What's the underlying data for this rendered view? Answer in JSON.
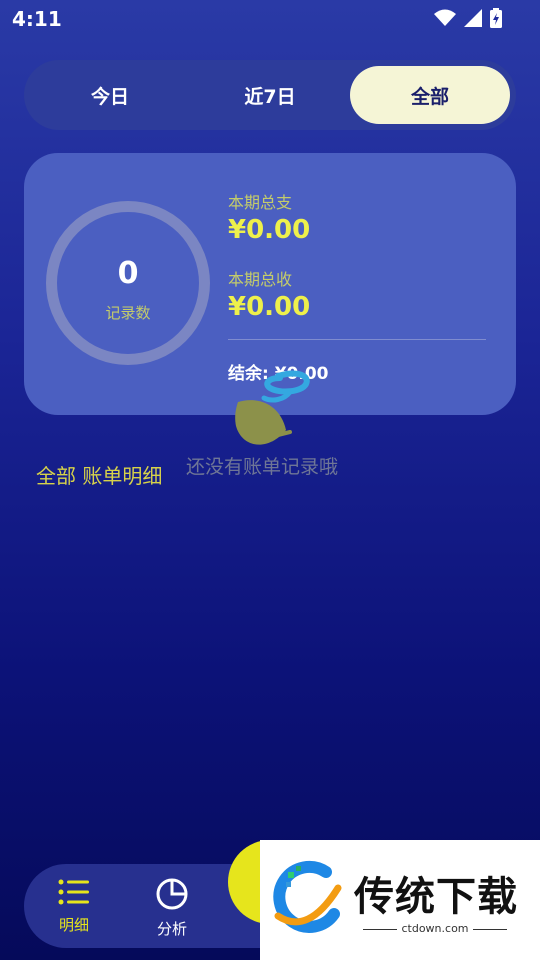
{
  "status_bar": {
    "time": "4:11",
    "icons": [
      "wifi-icon",
      "cell-signal-icon",
      "battery-charging-icon"
    ]
  },
  "range_tabs": [
    {
      "label": "今日",
      "active": false
    },
    {
      "label": "近7日",
      "active": false
    },
    {
      "label": "全部",
      "active": true
    }
  ],
  "summary": {
    "record_count": "0",
    "record_count_label": "记录数",
    "expense_label": "本期总支",
    "expense_value": "¥0.00",
    "income_label": "本期总收",
    "income_value": "¥0.00",
    "balance_text": "结余: ¥0.00"
  },
  "list": {
    "title": "全部 账单明细",
    "empty_text": "还没有账单记录哦"
  },
  "bottom_nav": [
    {
      "label": "明细",
      "icon": "list-icon",
      "active": true
    },
    {
      "label": "分析",
      "icon": "pie-chart-icon",
      "active": false
    }
  ],
  "watermark": {
    "title": "传统下载",
    "url": "ctdown.com"
  },
  "colors": {
    "accent_yellow": "#e6e51c",
    "card": "#4b5fc1",
    "active_tab": "#f5f5d6"
  }
}
